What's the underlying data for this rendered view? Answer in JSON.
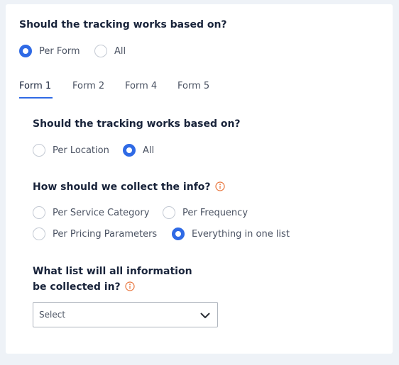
{
  "tracking_basis": {
    "question": "Should the tracking works based on?",
    "options": [
      {
        "label": "Per Form",
        "checked": true
      },
      {
        "label": "All",
        "checked": false
      }
    ]
  },
  "form_tabs": [
    {
      "label": "Form 1",
      "active": true
    },
    {
      "label": "Form 2",
      "active": false
    },
    {
      "label": "Form 4",
      "active": false
    },
    {
      "label": "Form 5",
      "active": false
    }
  ],
  "form_panel": {
    "tracking": {
      "question": "Should the tracking works based on?",
      "options": [
        {
          "label": "Per Location",
          "checked": false
        },
        {
          "label": "All",
          "checked": true
        }
      ]
    },
    "collection": {
      "question": "How should we collect the info?",
      "options": [
        {
          "label": "Per Service Category",
          "checked": false
        },
        {
          "label": "Per Frequency",
          "checked": false
        },
        {
          "label": "Per Pricing Parameters",
          "checked": false
        },
        {
          "label": "Everything in one list",
          "checked": true
        }
      ]
    },
    "list": {
      "question": "What list will all information be collected in?",
      "select_value": "Select"
    }
  },
  "colors": {
    "accent": "#2f6ae5",
    "info_icon": "#e8743b",
    "heading": "#18233a",
    "body_text": "#4a5262",
    "page_background": "#eef2f7"
  },
  "icons": {
    "info": "info-circle-icon",
    "dropdown": "chevron-down-icon"
  }
}
